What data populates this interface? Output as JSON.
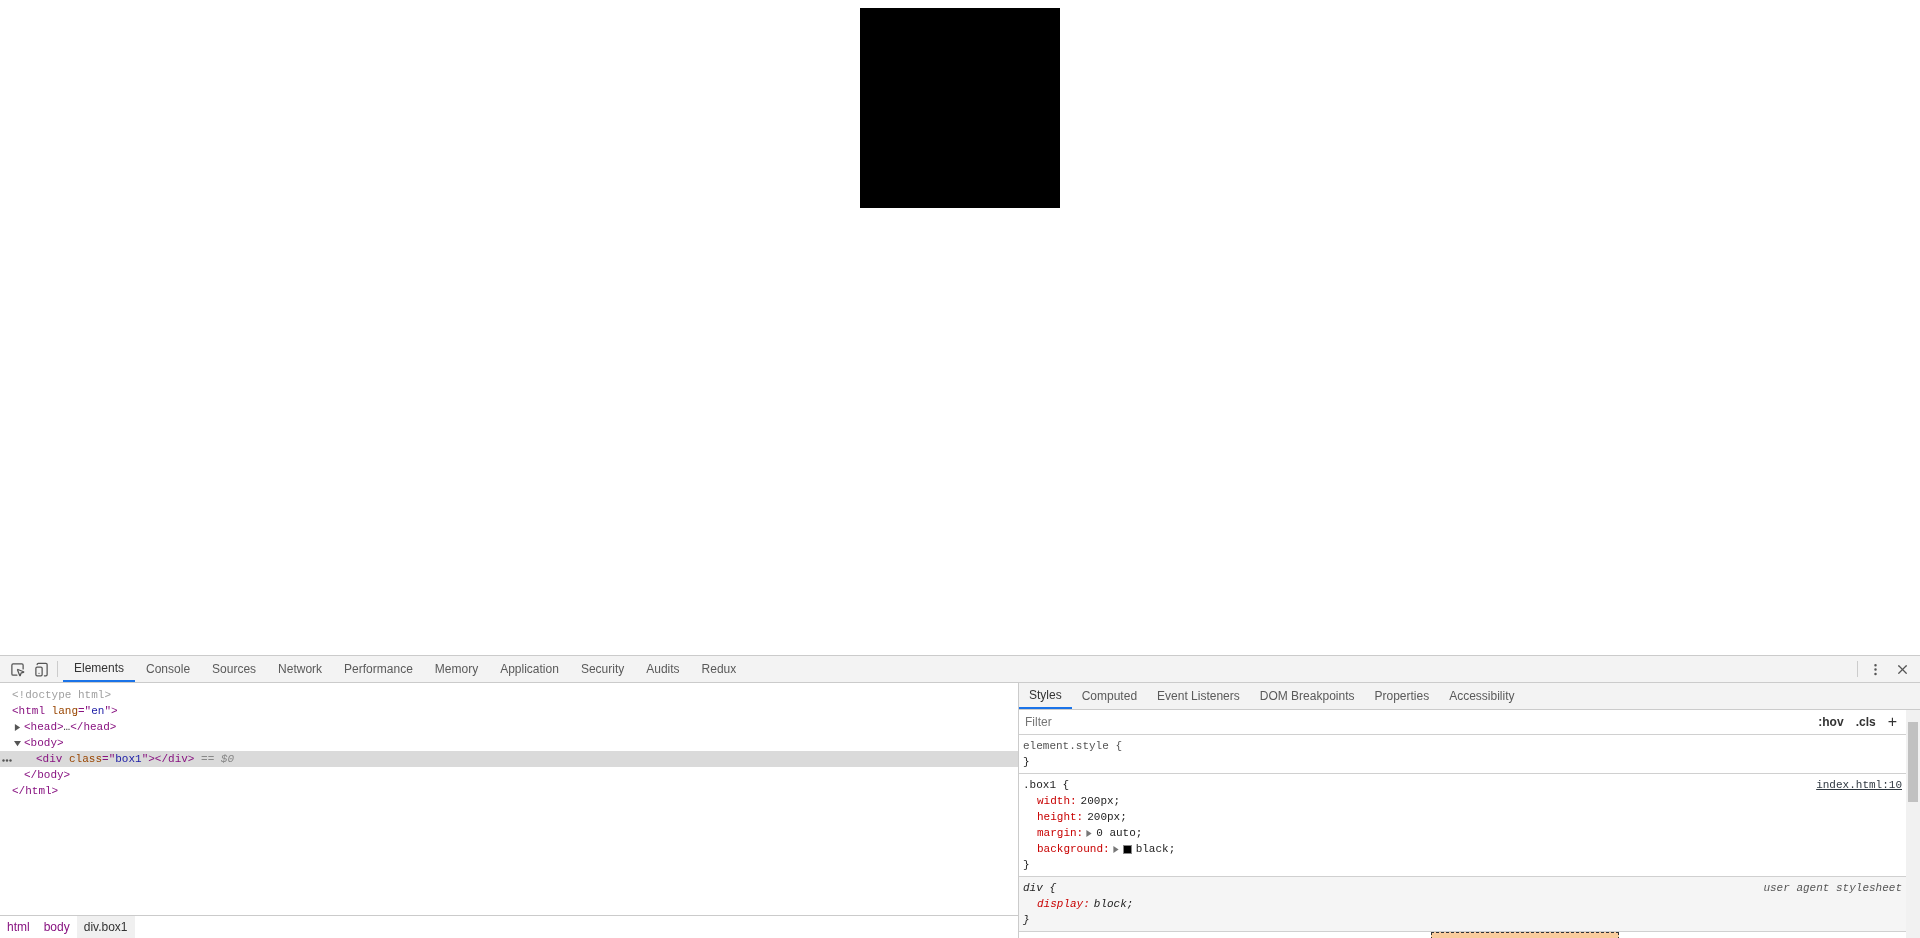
{
  "devtools": {
    "tabs": [
      {
        "label": "Elements",
        "selected": true
      },
      {
        "label": "Console",
        "selected": false
      },
      {
        "label": "Sources",
        "selected": false
      },
      {
        "label": "Network",
        "selected": false
      },
      {
        "label": "Performance",
        "selected": false
      },
      {
        "label": "Memory",
        "selected": false
      },
      {
        "label": "Application",
        "selected": false
      },
      {
        "label": "Security",
        "selected": false
      },
      {
        "label": "Audits",
        "selected": false
      },
      {
        "label": "Redux",
        "selected": false
      }
    ],
    "dom_tree": [
      {
        "tokens": [
          {
            "kind": "comment",
            "text": "<!doctype html>"
          }
        ],
        "selected": false
      },
      {
        "tokens": [
          {
            "kind": "tag",
            "text": "<html "
          },
          {
            "kind": "attr",
            "text": "lang"
          },
          {
            "kind": "tag",
            "text": "=\""
          },
          {
            "kind": "value",
            "text": "en"
          },
          {
            "kind": "tag",
            "text": "\">"
          }
        ],
        "selected": false,
        "closing": [
          {
            "kind": "tag",
            "text": "</html>"
          }
        ],
        "children": [
          {
            "tokens": [
              {
                "kind": "tag",
                "text": "<head>"
              },
              {
                "kind": "plain",
                "text": "…"
              },
              {
                "kind": "tag",
                "text": "</head>"
              }
            ],
            "expanded": false,
            "selected": false
          },
          {
            "tokens": [
              {
                "kind": "tag",
                "text": "<body>"
              }
            ],
            "expanded": true,
            "selected": false,
            "closing": [
              {
                "kind": "tag",
                "text": "</body>"
              }
            ],
            "children": [
              {
                "tokens": [
                  {
                    "kind": "tag",
                    "text": "<div "
                  },
                  {
                    "kind": "attr",
                    "text": "class"
                  },
                  {
                    "kind": "tag",
                    "text": "=\""
                  },
                  {
                    "kind": "value",
                    "text": "box1"
                  },
                  {
                    "kind": "tag",
                    "text": "\"></div>"
                  },
                  {
                    "kind": "hint",
                    "text": " == $0"
                  }
                ],
                "selected": true
              }
            ]
          }
        ]
      }
    ],
    "breadcrumbs": [
      {
        "label": "html",
        "selected": false
      },
      {
        "label": "body",
        "selected": false
      },
      {
        "label": "div.box1",
        "selected": true
      }
    ],
    "sidebar_tabs": [
      {
        "label": "Styles",
        "selected": true
      },
      {
        "label": "Computed",
        "selected": false
      },
      {
        "label": "Event Listeners",
        "selected": false
      },
      {
        "label": "DOM Breakpoints",
        "selected": false
      },
      {
        "label": "Properties",
        "selected": false
      },
      {
        "label": "Accessibility",
        "selected": false
      }
    ],
    "filter": {
      "placeholder": "Filter"
    },
    "filter_buttons": [
      ":hov",
      ".cls",
      "+"
    ],
    "rules": [
      {
        "kind": "inline",
        "selector": "element.style {",
        "close": "}"
      },
      {
        "kind": "author",
        "selector": ".box1 {",
        "source": "index.html:10",
        "close": "}",
        "declarations": [
          {
            "property": "width:",
            "value": "200px;",
            "expandable": false
          },
          {
            "property": "height:",
            "value": "200px;",
            "expandable": false
          },
          {
            "property": "margin:",
            "value": "0 auto;",
            "expandable": true
          },
          {
            "property": "background:",
            "value": "black;",
            "expandable": true,
            "color": "#000000"
          }
        ]
      },
      {
        "kind": "user-agent",
        "selector": "div {",
        "source": "user agent stylesheet",
        "close": "}",
        "declarations": [
          {
            "property": "display:",
            "value": "block;",
            "expandable": false
          }
        ]
      }
    ]
  }
}
